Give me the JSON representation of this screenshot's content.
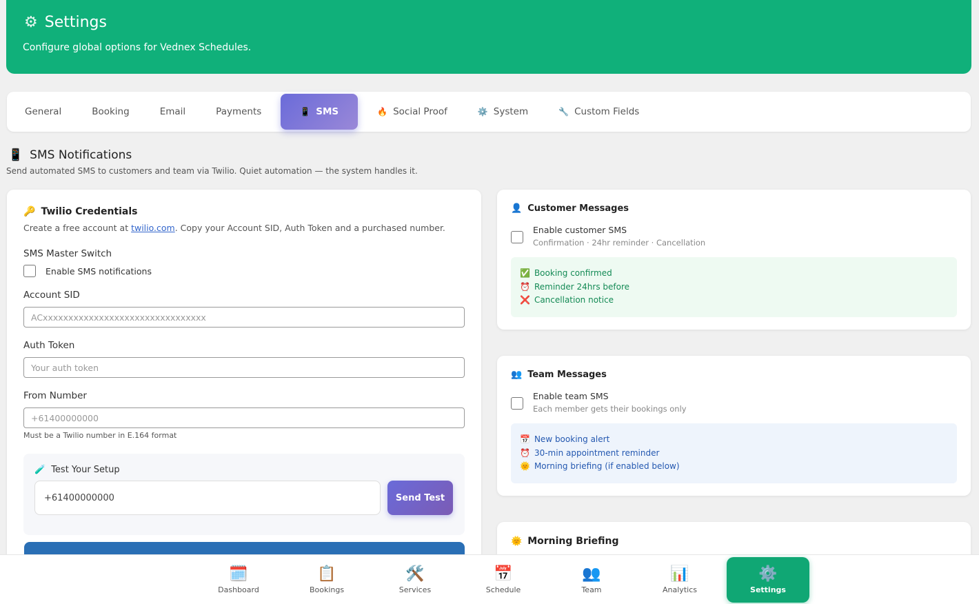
{
  "header": {
    "icon": "gear-icon",
    "title": "Settings",
    "subtitle": "Configure global options for Vednex Schedules."
  },
  "tabs": [
    {
      "label": "General"
    },
    {
      "label": "Booking"
    },
    {
      "label": "Email"
    },
    {
      "label": "Payments"
    },
    {
      "label": "SMS",
      "icon": "📱",
      "active": true
    },
    {
      "label": "Social Proof",
      "icon": "🔥"
    },
    {
      "label": "System",
      "icon": "⚙️"
    },
    {
      "label": "Custom Fields",
      "icon": "🔧"
    }
  ],
  "section": {
    "title": "SMS Notifications",
    "subtitle": "Send automated SMS to customers and team via Twilio. Quiet automation — the system handles it."
  },
  "twilio": {
    "title": "Twilio Credentials",
    "desc_pre": "Create a free account at ",
    "desc_link": "twilio.com",
    "desc_post": ". Copy your Account SID, Auth Token and a purchased number.",
    "master_label": "SMS Master Switch",
    "master_checkbox_label": "Enable SMS notifications",
    "sid_label": "Account SID",
    "sid_placeholder": "ACxxxxxxxxxxxxxxxxxxxxxxxxxxxxxxxx",
    "token_label": "Auth Token",
    "token_placeholder": "Your auth token",
    "from_label": "From Number",
    "from_placeholder": "+61400000000",
    "from_hint": "Must be a Twilio number in E.164 format",
    "test_title": "Test Your Setup",
    "test_value": "+61400000000",
    "send_label": "Send Test"
  },
  "customer": {
    "title": "Customer Messages",
    "checkbox_label": "Enable customer SMS",
    "checkbox_sub": "Confirmation · 24hr reminder · Cancellation",
    "items": [
      "Booking confirmed",
      "Reminder 24hrs before",
      "Cancellation notice"
    ]
  },
  "team": {
    "title": "Team Messages",
    "checkbox_label": "Enable team SMS",
    "checkbox_sub": "Each member gets their bookings only",
    "items": [
      "New booking alert",
      "30-min appointment reminder",
      "Morning briefing (if enabled below)"
    ]
  },
  "morning": {
    "title": "Morning Briefing"
  },
  "nav": [
    {
      "label": "Dashboard",
      "icon": "calendar-grid-icon"
    },
    {
      "label": "Bookings",
      "icon": "clipboard-icon"
    },
    {
      "label": "Services",
      "icon": "tools-icon"
    },
    {
      "label": "Schedule",
      "icon": "calendar-icon"
    },
    {
      "label": "Team",
      "icon": "people-icon"
    },
    {
      "label": "Analytics",
      "icon": "bar-chart-icon"
    },
    {
      "label": "Settings",
      "icon": "gear-icon",
      "active": true
    }
  ],
  "colors": {
    "brand_green": "#10b07a",
    "accent_purple": "#6a6bd9",
    "link_blue": "#3366cc"
  }
}
